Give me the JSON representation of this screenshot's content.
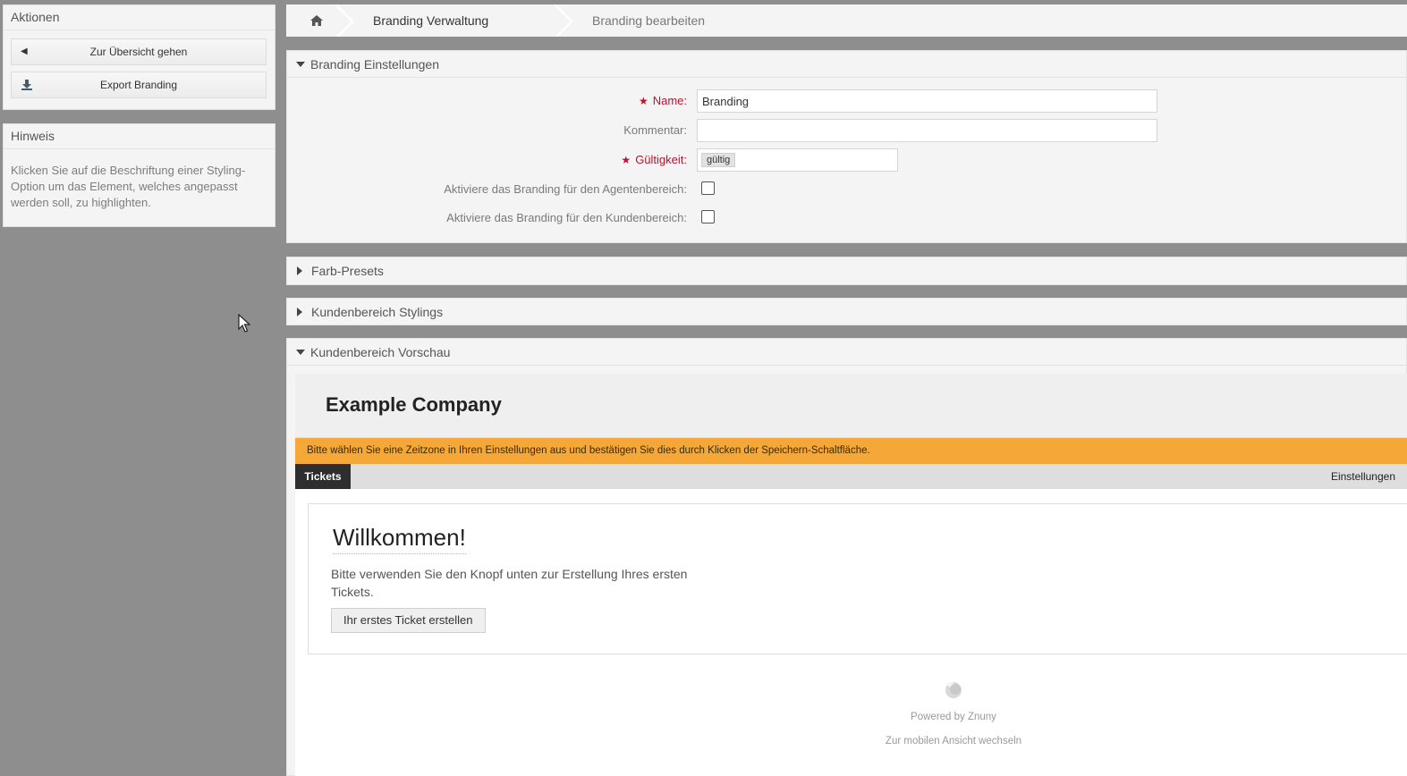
{
  "sidebar": {
    "actions": {
      "title": "Aktionen",
      "buttons": [
        {
          "label": "Zur Übersicht gehen",
          "icon": "caret-left-icon"
        },
        {
          "label": "Export Branding",
          "icon": "download-icon"
        }
      ]
    },
    "hint": {
      "title": "Hinweis",
      "text": "Klicken Sie auf die Beschriftung einer Styling-Option um das Element, welches angepasst werden soll, zu highlighten."
    }
  },
  "breadcrumb": {
    "home_icon": "home-icon",
    "items": [
      "Branding Verwaltung",
      "Branding bearbeiten"
    ]
  },
  "settings_panel": {
    "title": "Branding Einstellungen",
    "fields": {
      "name": {
        "label": "Name:",
        "value": "Branding",
        "required": true
      },
      "comment": {
        "label": "Kommentar:",
        "value": ""
      },
      "validity": {
        "label": "Gültigkeit:",
        "value": "gültig",
        "required": true
      },
      "agent": {
        "label": "Aktiviere das Branding für den Agentenbereich:",
        "checked": false
      },
      "customer": {
        "label": "Aktiviere das Branding für den Kundenbereich:",
        "checked": false
      }
    }
  },
  "collapsed_panels": [
    "Farb-Presets",
    "Kundenbereich Stylings"
  ],
  "preview_panel": {
    "title": "Kundenbereich Vorschau",
    "company": "Example Company",
    "banner": "Bitte wählen Sie eine Zeitzone in Ihren Einstellungen aus und bestätigen Sie dies durch Klicken der Speichern-Schaltfläche.",
    "nav": {
      "active_tab": "Tickets",
      "settings": "Einstellungen"
    },
    "welcome_title": "Willkommen!",
    "welcome_text": "Bitte verwenden Sie den Knopf unten zur Erstellung Ihres ersten Tickets.",
    "create_button": "Ihr erstes Ticket erstellen",
    "powered_by": "Powered by Znuny",
    "mobile_link": "Zur mobilen Ansicht wechseln"
  },
  "colors": {
    "background": "#8e8e8e",
    "panel": "#f4f4f4",
    "required": "#c0102f",
    "banner": "#f5a837",
    "tab_active": "#2e2e2e"
  }
}
